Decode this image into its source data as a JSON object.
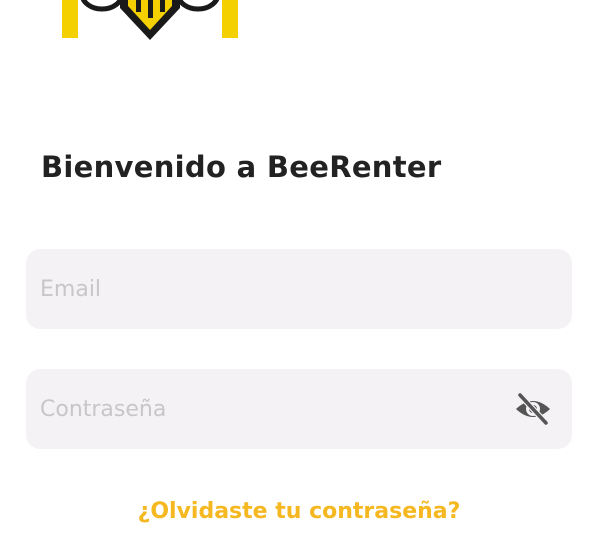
{
  "app": {
    "logo_icon": "bee-logo-icon",
    "brand_color": "#f5d000",
    "accent_color": "#f5b821"
  },
  "login": {
    "title": "Bienvenido a BeeRenter",
    "email_placeholder": "Email",
    "email_value": "",
    "password_placeholder": "Contraseña",
    "password_value": "",
    "visibility_icon": "eye-off-icon",
    "forgot_password": "¿Olvidaste tu contraseña?"
  }
}
